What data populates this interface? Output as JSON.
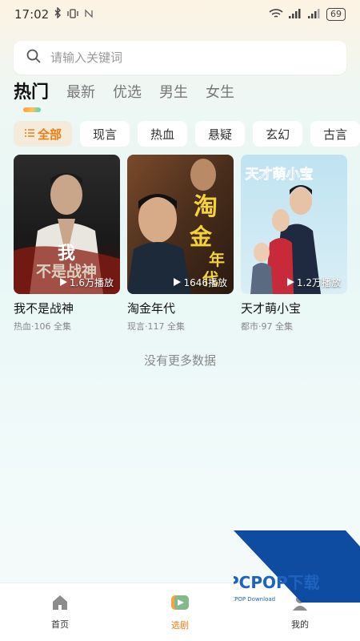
{
  "status": {
    "time": "17:02",
    "battery": "69"
  },
  "search": {
    "placeholder": "请输入关键词"
  },
  "tabs": [
    {
      "label": "热门"
    },
    {
      "label": "最新"
    },
    {
      "label": "优选"
    },
    {
      "label": "男生"
    },
    {
      "label": "女生"
    }
  ],
  "categories": [
    {
      "label": "全部"
    },
    {
      "label": "现言"
    },
    {
      "label": "热血"
    },
    {
      "label": "悬疑"
    },
    {
      "label": "玄幻"
    },
    {
      "label": "古言"
    }
  ],
  "dramas": [
    {
      "title": "我不是战神",
      "meta": "热血·106 全集",
      "plays": "1.6万播放",
      "poster_text": "我不是战神"
    },
    {
      "title": "淘金年代",
      "meta": "现言·117 全集",
      "plays": "1646播放",
      "poster_text": "淘金年代"
    },
    {
      "title": "天才萌小宝",
      "meta": "都市·97 全集",
      "plays": "1.2万播放",
      "poster_text": "天才萌小宝"
    }
  ],
  "empty_hint": "没有更多数据",
  "nav": [
    {
      "label": "首页"
    },
    {
      "label": "选剧"
    },
    {
      "label": "我的"
    }
  ],
  "watermark": {
    "brand": "PCPOP下载",
    "sub": "PCPOP Download"
  },
  "colors": {
    "accent": "#f07c14",
    "chip_active_bg": "#f5ebda"
  }
}
